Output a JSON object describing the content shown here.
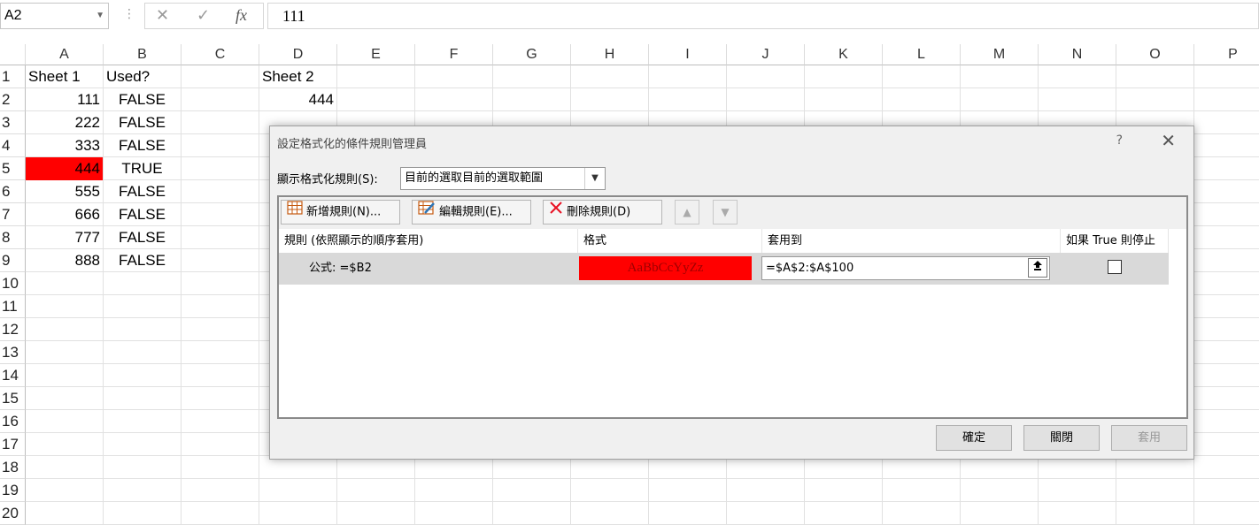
{
  "formula_bar": {
    "name_box": "A2",
    "cancel_glyph": "✕",
    "enter_glyph": "✓",
    "fx_label": "fx",
    "formula_value": "111"
  },
  "columns": [
    "A",
    "B",
    "C",
    "D",
    "E",
    "F",
    "G",
    "H",
    "I",
    "J",
    "K",
    "L",
    "M",
    "N",
    "O",
    "P"
  ],
  "rows": [
    "1",
    "2",
    "3",
    "4",
    "5",
    "6",
    "7",
    "8",
    "9",
    "10",
    "11",
    "12",
    "13",
    "14",
    "15",
    "16",
    "17",
    "18",
    "19",
    "20"
  ],
  "cells": {
    "A1": "Sheet 1",
    "B1": "Used?",
    "D1": "Sheet 2",
    "A2": "111",
    "B2": "FALSE",
    "D2": "444",
    "A3": "222",
    "B3": "FALSE",
    "A4": "333",
    "B4": "FALSE",
    "A5": "444",
    "B5": "TRUE",
    "A6": "555",
    "B6": "FALSE",
    "A7": "666",
    "B7": "FALSE",
    "A8": "777",
    "B8": "FALSE",
    "A9": "888",
    "B9": "FALSE"
  },
  "highlight_color": "#ff0000",
  "dialog": {
    "title": "設定格式化的條件規則管理員",
    "help": "?",
    "close": "✕",
    "show_rules_label": "顯示格式化規則(S):",
    "show_rules_value": "目前的選取目前的選取範圍",
    "toolbar": {
      "new_rule": "新增規則(N)...",
      "edit_rule": "編輯規則(E)...",
      "delete_rule": "刪除規則(D)"
    },
    "headers": {
      "rule": "規則 (依照顯示的順序套用)",
      "format": "格式",
      "applies_to": "套用到",
      "stop_if_true": "如果 True 則停止"
    },
    "rule": {
      "formula": "公式: =$B2",
      "format_preview": "AaBbCcYyZz",
      "applies_to": "=$A$2:$A$100",
      "stop_if_true": false
    },
    "buttons": {
      "ok": "確定",
      "close": "關閉",
      "apply": "套用"
    }
  }
}
